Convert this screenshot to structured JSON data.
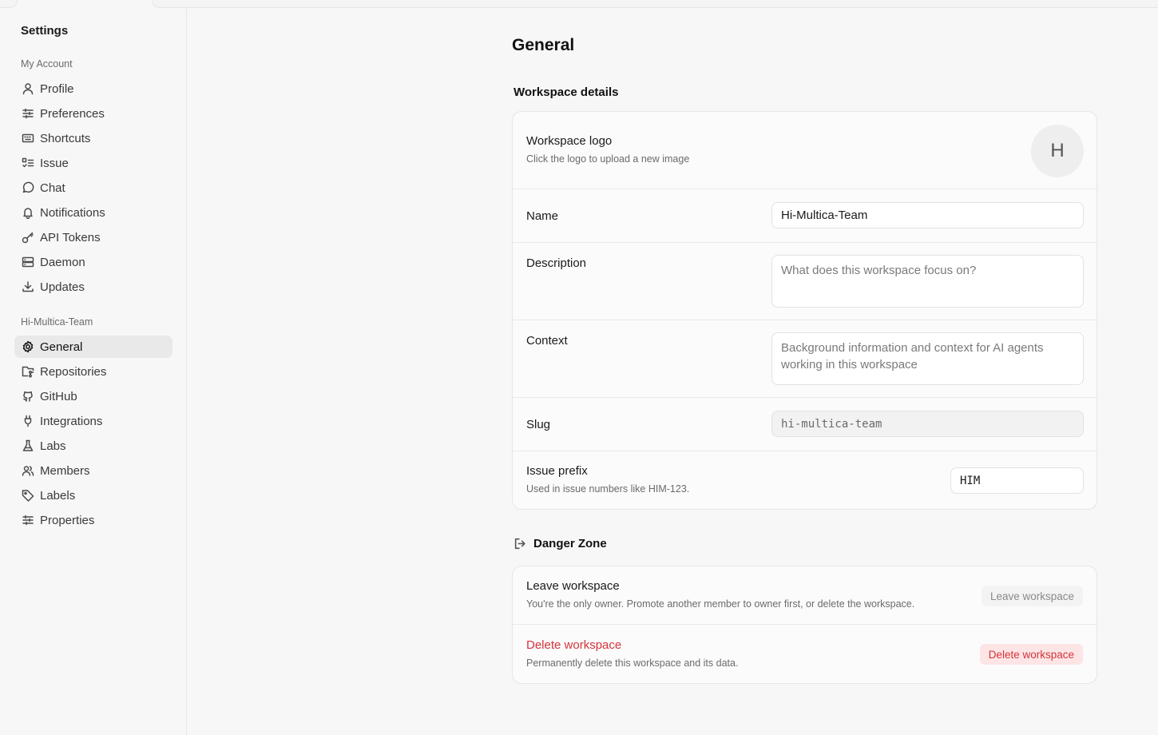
{
  "sidebar": {
    "title": "Settings",
    "account_label": "My Account",
    "account_items": [
      {
        "label": "Profile",
        "icon": "user-icon"
      },
      {
        "label": "Preferences",
        "icon": "sliders-icon"
      },
      {
        "label": "Shortcuts",
        "icon": "keyboard-icon"
      },
      {
        "label": "Issue",
        "icon": "list-todo-icon"
      },
      {
        "label": "Chat",
        "icon": "message-circle-icon"
      },
      {
        "label": "Notifications",
        "icon": "bell-icon"
      },
      {
        "label": "API Tokens",
        "icon": "key-icon"
      },
      {
        "label": "Daemon",
        "icon": "server-icon"
      },
      {
        "label": "Updates",
        "icon": "download-icon"
      }
    ],
    "workspace_label": "Hi-Multica-Team",
    "workspace_items": [
      {
        "label": "General",
        "icon": "gear-icon",
        "active": true
      },
      {
        "label": "Repositories",
        "icon": "folder-git-icon"
      },
      {
        "label": "GitHub",
        "icon": "github-icon"
      },
      {
        "label": "Integrations",
        "icon": "plug-icon"
      },
      {
        "label": "Labs",
        "icon": "flask-icon"
      },
      {
        "label": "Members",
        "icon": "users-icon"
      },
      {
        "label": "Labels",
        "icon": "tag-icon"
      },
      {
        "label": "Properties",
        "icon": "sliders-icon"
      }
    ]
  },
  "main": {
    "title": "General",
    "details": {
      "title": "Workspace details",
      "logo": {
        "label": "Workspace logo",
        "hint": "Click the logo to upload a new image",
        "initial": "H"
      },
      "name": {
        "label": "Name",
        "value": "Hi-Multica-Team"
      },
      "description": {
        "label": "Description",
        "placeholder": "What does this workspace focus on?"
      },
      "context": {
        "label": "Context",
        "placeholder": "Background information and context for AI agents working in this workspace"
      },
      "slug": {
        "label": "Slug",
        "value": "hi-multica-team"
      },
      "prefix": {
        "label": "Issue prefix",
        "hint": "Used in issue numbers like HIM-123.",
        "value": "HIM"
      }
    },
    "danger": {
      "title": "Danger Zone",
      "leave": {
        "label": "Leave workspace",
        "hint": "You're the only owner. Promote another member to owner first, or delete the workspace.",
        "button": "Leave workspace"
      },
      "delete": {
        "label": "Delete workspace",
        "hint": "Permanently delete this workspace and its data.",
        "button": "Delete workspace"
      }
    }
  },
  "colors": {
    "danger": "#d4343a",
    "danger_bg": "#fde5e5",
    "active_bg": "#e9e9e9"
  }
}
